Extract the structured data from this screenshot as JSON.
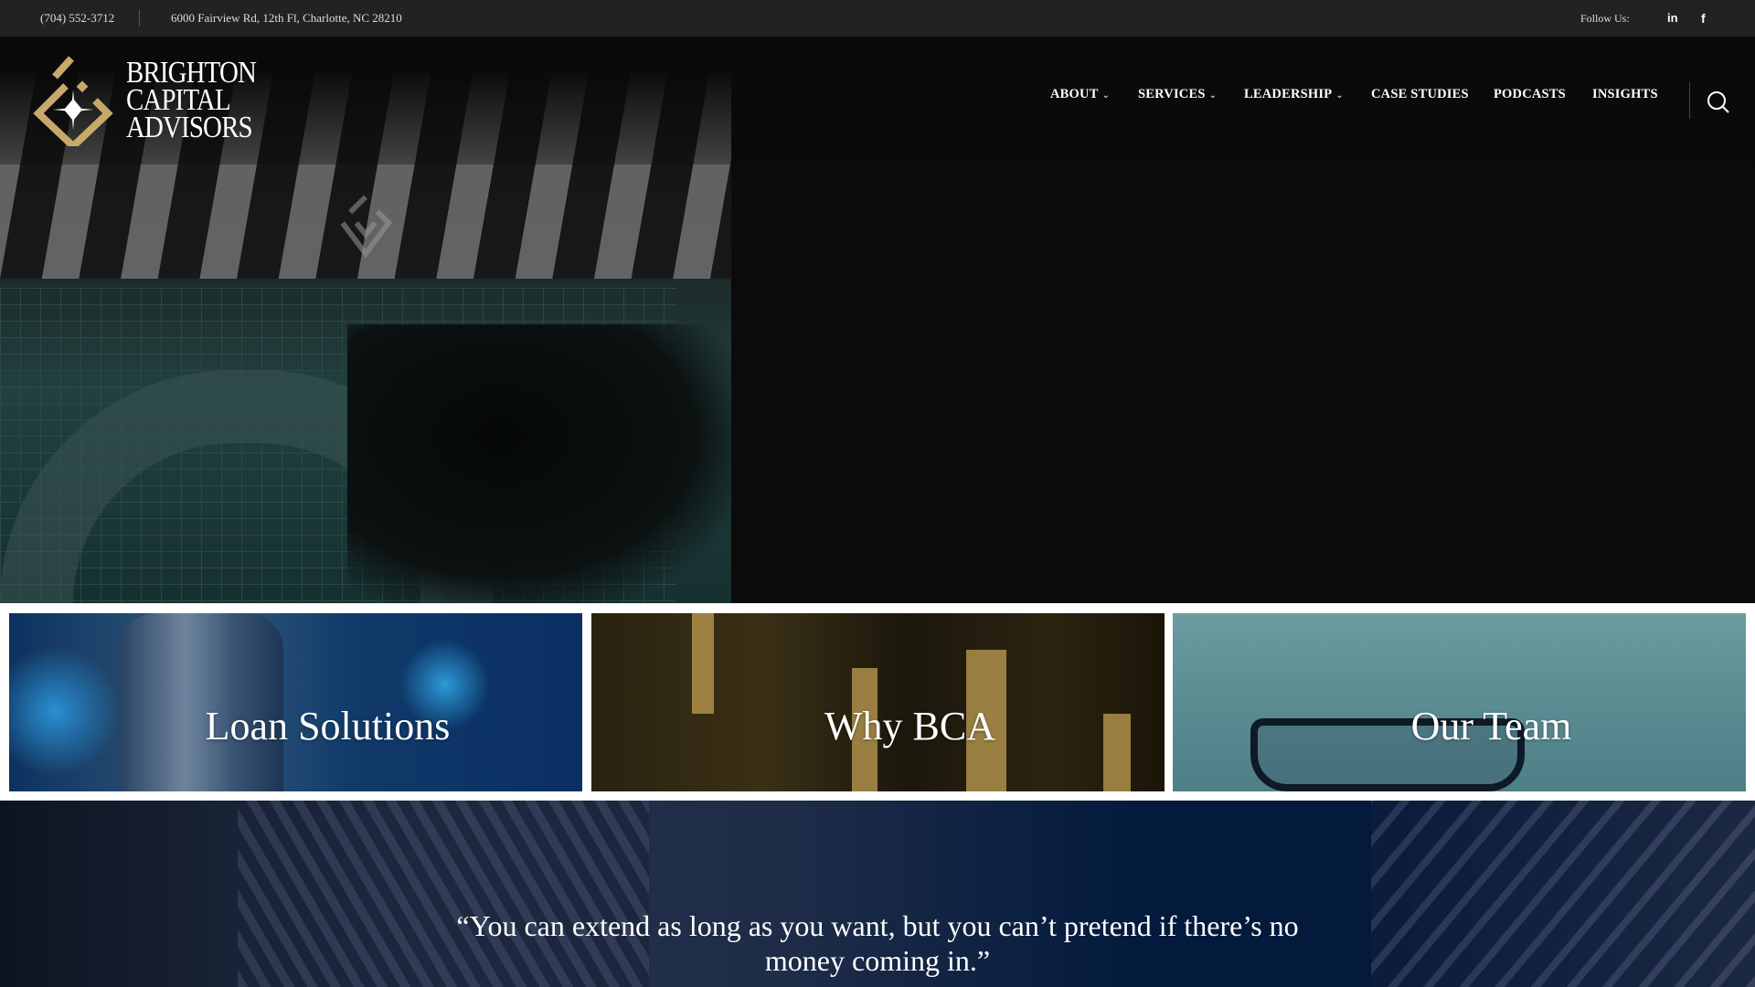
{
  "topbar": {
    "phone": "(704) 552-3712",
    "address": "6000 Fairview Rd, 12th Fl, Charlotte, NC 28210",
    "follow_label": "Follow Us:",
    "social": [
      "linkedin-icon",
      "facebook-icon"
    ],
    "linkedin_glyph": "in",
    "facebook_glyph": "f"
  },
  "logo": {
    "line1": "BRIGHTON",
    "line2": "CAPITAL",
    "line3": "ADVISORS"
  },
  "nav": {
    "items": [
      {
        "label": "ABOUT",
        "dropdown": true
      },
      {
        "label": "SERVICES",
        "dropdown": true
      },
      {
        "label": "LEADERSHIP",
        "dropdown": true
      },
      {
        "label": "CASE STUDIES",
        "dropdown": false
      },
      {
        "label": "PODCASTS",
        "dropdown": false
      },
      {
        "label": "INSIGHTS",
        "dropdown": false
      }
    ],
    "chevron": "⌄"
  },
  "cards": [
    {
      "title": "Loan Solutions"
    },
    {
      "title": "Why BCA"
    },
    {
      "title": "Our Team"
    }
  ],
  "quote": {
    "text": "“You can extend as long as you want, but you can’t pretend if there’s no money coming in.”"
  },
  "colors": {
    "gold": "#c8a96a",
    "topbar": "#222222",
    "header": "#0a0a0a"
  }
}
